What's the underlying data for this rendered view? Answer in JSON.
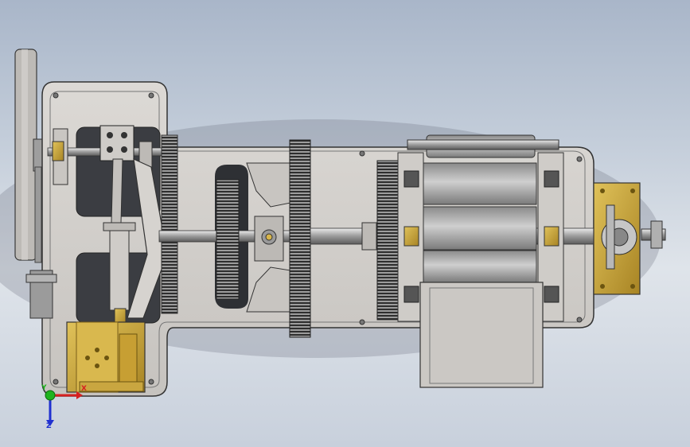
{
  "view": {
    "background_top": "#a9b6c9",
    "background_bottom": "#dfe4ea",
    "part_color": "#d3d0cc",
    "edge_color": "#3a3a3a",
    "brass_color": "#c9a640"
  },
  "triad": {
    "x_label": "X",
    "y_label": "Y",
    "z_label": "Z",
    "x_color": "#d62020",
    "y_color": "#1fb31f",
    "z_color": "#2030d0"
  }
}
